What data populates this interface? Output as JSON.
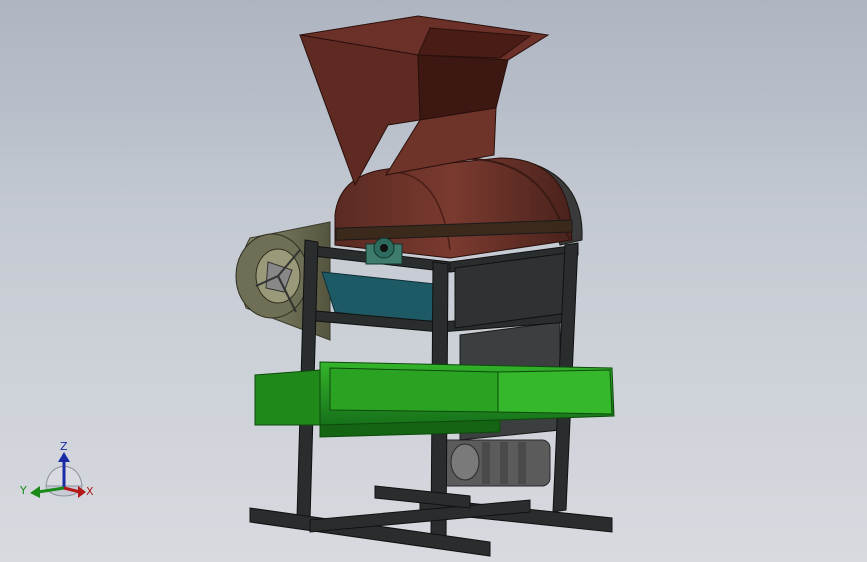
{
  "viewport": {
    "background_top": "#aeb5c1",
    "background_bottom": "#d7dadf"
  },
  "model": {
    "hopper_color": "#6b3128",
    "hopper_inner_color": "#3d1712",
    "drum_color": "#6a3329",
    "frame_color": "#2a2d2e",
    "tray_color": "#1f8a1a",
    "trough_color": "#1e5a66",
    "bearing_color": "#3e7c6e",
    "motor_color": "#5b5b5b",
    "fan_housing_color": "#6a6a52"
  },
  "triad": {
    "z_label": "Z",
    "y_label": "Y",
    "x_label": "X",
    "z_color": "#1b2aa6",
    "y_color": "#1b8a1b",
    "x_color": "#b21a1a"
  }
}
